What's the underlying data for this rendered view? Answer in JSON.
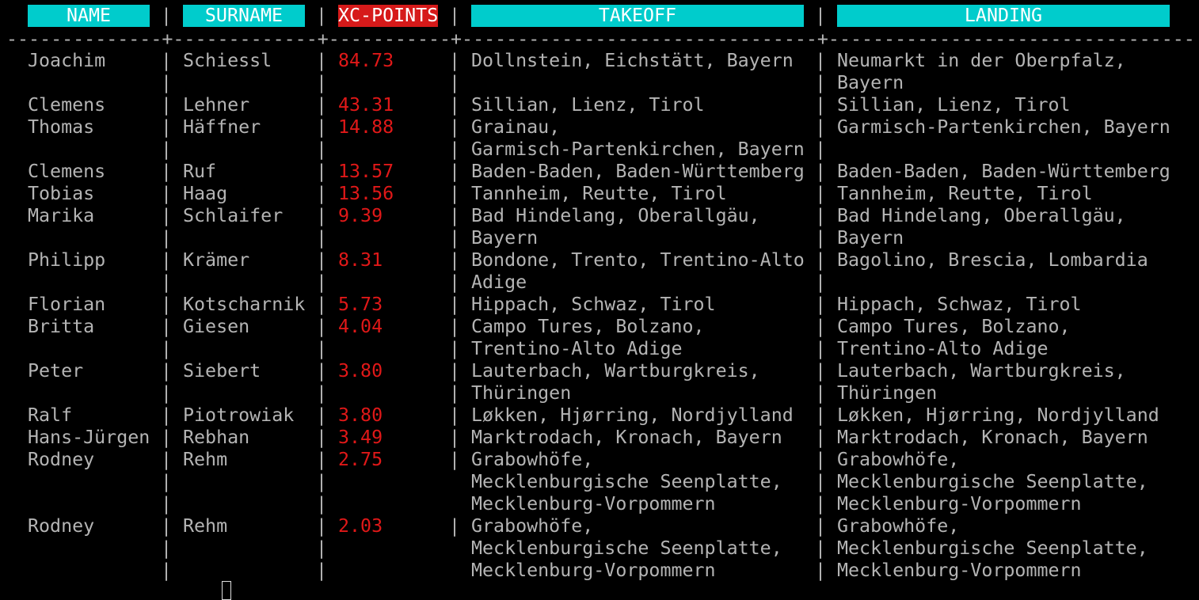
{
  "headers": {
    "name": "NAME",
    "surname": "SURNAME",
    "points": "XC-POINTS",
    "takeoff": "TAKEOFF",
    "landing": "LANDING"
  },
  "separator_char": "|",
  "rule_text": "--------------+-------------+-----------+---------------------------------+-------------------------------------------------------------------------------------------------",
  "rows": [
    {
      "name": "Joachim",
      "surname": "Schiessl",
      "points": "84.73",
      "takeoff": [
        "Dollnstein, Eichstätt, Bayern"
      ],
      "landing": [
        "Neumarkt in der Oberpfalz,",
        "Bayern"
      ]
    },
    {
      "name": "Clemens",
      "surname": "Lehner",
      "points": "43.31",
      "takeoff": [
        "Sillian, Lienz, Tirol"
      ],
      "landing": [
        "Sillian, Lienz, Tirol"
      ]
    },
    {
      "name": "Thomas",
      "surname": "Häffner",
      "points": "14.88",
      "takeoff": [
        "Grainau,",
        "Garmisch-Partenkirchen, Bayern"
      ],
      "landing": [
        "Garmisch-Partenkirchen, Bayern"
      ]
    },
    {
      "name": "Clemens",
      "surname": "Ruf",
      "points": "13.57",
      "takeoff": [
        "Baden-Baden, Baden-Württemberg"
      ],
      "landing": [
        "Baden-Baden, Baden-Württemberg"
      ]
    },
    {
      "name": "Tobias",
      "surname": "Haag",
      "points": "13.56",
      "takeoff": [
        "Tannheim, Reutte, Tirol"
      ],
      "landing": [
        "Tannheim, Reutte, Tirol"
      ]
    },
    {
      "name": "Marika",
      "surname": "Schlaifer",
      "points": "9.39",
      "takeoff": [
        "Bad Hindelang, Oberallgäu,",
        "Bayern"
      ],
      "landing": [
        "Bad Hindelang, Oberallgäu,",
        "Bayern"
      ]
    },
    {
      "name": "Philipp",
      "surname": "Krämer",
      "points": "8.31",
      "takeoff": [
        "Bondone, Trento, Trentino-Alto",
        "Adige"
      ],
      "landing": [
        "Bagolino, Brescia, Lombardia"
      ]
    },
    {
      "name": "Florian",
      "surname": "Kotscharnik",
      "points": "5.73",
      "takeoff": [
        "Hippach, Schwaz, Tirol"
      ],
      "landing": [
        "Hippach, Schwaz, Tirol"
      ]
    },
    {
      "name": "Britta",
      "surname": "Giesen",
      "points": "4.04",
      "takeoff": [
        "Campo Tures, Bolzano,",
        "Trentino-Alto Adige"
      ],
      "landing": [
        "Campo Tures, Bolzano,",
        "Trentino-Alto Adige"
      ]
    },
    {
      "name": "Peter",
      "surname": "Siebert",
      "points": "3.80",
      "takeoff": [
        "Lauterbach, Wartburgkreis,",
        "Thüringen"
      ],
      "landing": [
        "Lauterbach, Wartburgkreis,",
        "Thüringen"
      ]
    },
    {
      "name": "Ralf",
      "surname": "Piotrowiak",
      "points": "3.80",
      "takeoff": [
        "Løkken, Hjørring, Nordjylland"
      ],
      "landing": [
        "Løkken, Hjørring, Nordjylland"
      ]
    },
    {
      "name": "Hans-Jürgen",
      "surname": "Rebhan",
      "points": "3.49",
      "takeoff": [
        "Marktrodach, Kronach, Bayern"
      ],
      "landing": [
        "Marktrodach, Kronach, Bayern"
      ]
    },
    {
      "name": "Rodney",
      "surname": "Rehm",
      "points": "2.75",
      "takeoff": [
        "Grabowhöfe,",
        "Mecklenburgische Seenplatte,",
        "Mecklenburg-Vorpommern"
      ],
      "landing": [
        "Grabowhöfe,",
        "Mecklenburgische Seenplatte,",
        "Mecklenburg-Vorpommern"
      ]
    },
    {
      "name": "Rodney",
      "surname": "Rehm",
      "points": "2.03",
      "takeoff": [
        "Grabowhöfe,",
        "Mecklenburgische Seenplatte,",
        "Mecklenburg-Vorpommern"
      ],
      "landing": [
        "Grabowhöfe,",
        "Mecklenburgische Seenplatte,",
        "Mecklenburg-Vorpommern"
      ]
    }
  ],
  "colors": {
    "background": "#000000",
    "text": "#b4b4b4",
    "header_bg": "#00cccc",
    "points_header_bg": "#d61a1a",
    "points_text": "#e01818"
  }
}
